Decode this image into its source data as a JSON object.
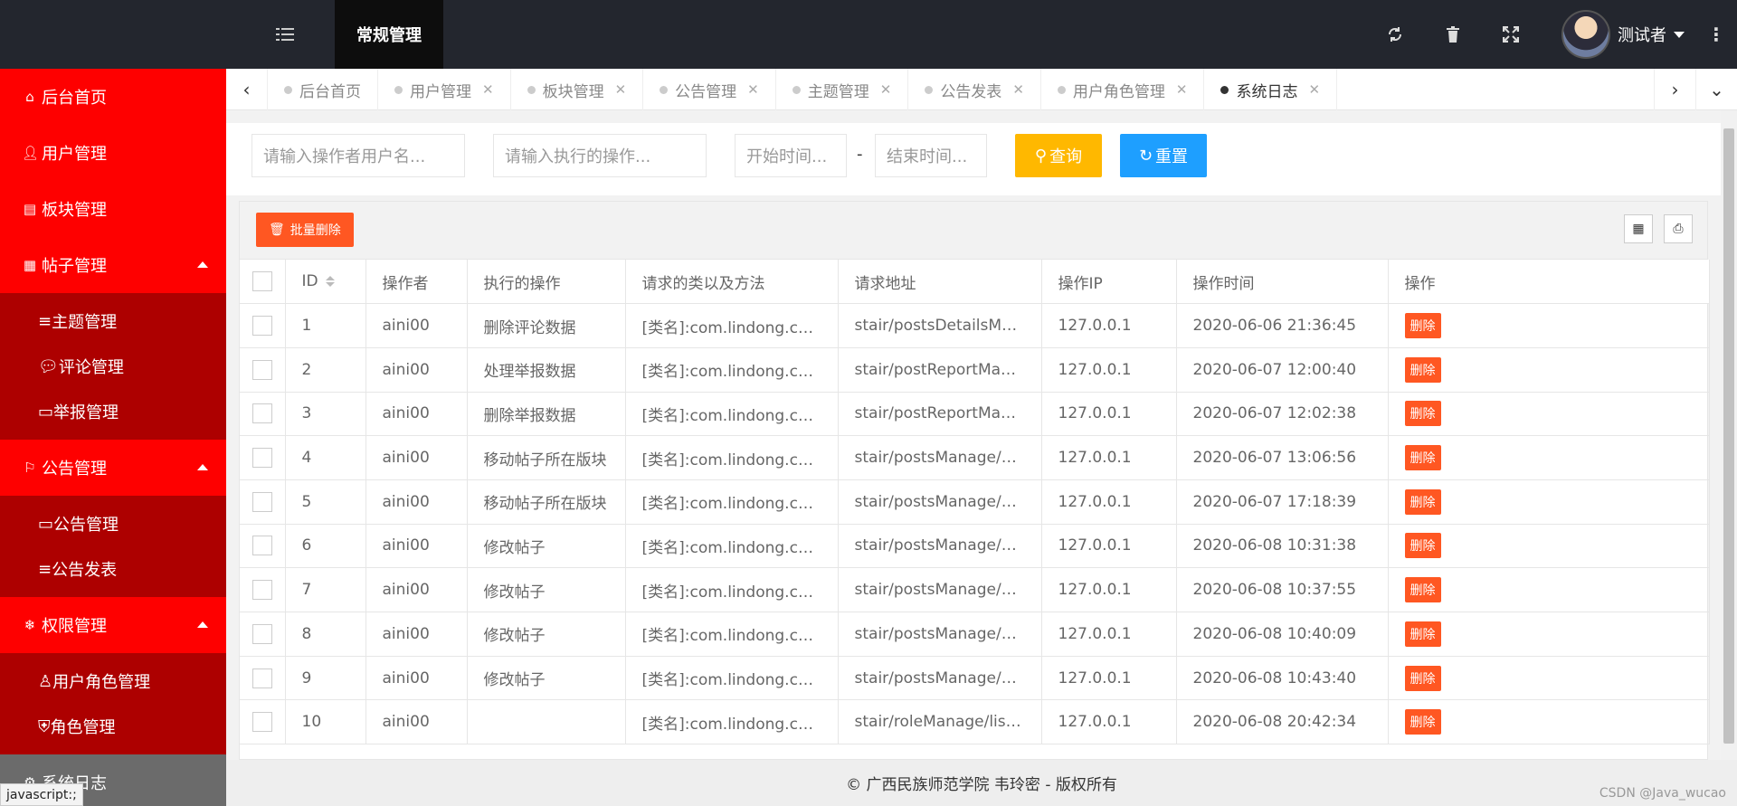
{
  "header": {
    "module": "常规管理",
    "user_name": "测试者"
  },
  "sidebar": {
    "items": [
      {
        "label": "后台首页",
        "icon": "home-icon"
      },
      {
        "label": "用户管理",
        "icon": "user-icon"
      },
      {
        "label": "板块管理",
        "icon": "file-icon"
      },
      {
        "label": "帖子管理",
        "icon": "calendar-icon",
        "expanded": true
      },
      {
        "label": "主题管理",
        "icon": "list-icon"
      },
      {
        "label": "评论管理",
        "icon": "comment-icon"
      },
      {
        "label": "举报管理",
        "icon": "card-icon"
      },
      {
        "label": "公告管理",
        "icon": "flag-icon",
        "expanded": true
      },
      {
        "label": "公告管理",
        "icon": "card-icon"
      },
      {
        "label": "公告发表",
        "icon": "list-icon"
      },
      {
        "label": "权限管理",
        "icon": "snowflake-icon",
        "expanded": true
      },
      {
        "label": "用户角色管理",
        "icon": "user-role-icon"
      },
      {
        "label": "角色管理",
        "icon": "shield-icon"
      },
      {
        "label": "系统日志",
        "icon": "gear-icon"
      }
    ]
  },
  "tabs": [
    {
      "label": "后台首页",
      "closable": false
    },
    {
      "label": "用户管理",
      "closable": true
    },
    {
      "label": "板块管理",
      "closable": true
    },
    {
      "label": "公告管理",
      "closable": true
    },
    {
      "label": "主题管理",
      "closable": true
    },
    {
      "label": "公告发表",
      "closable": true
    },
    {
      "label": "用户角色管理",
      "closable": true
    },
    {
      "label": "系统日志",
      "closable": true,
      "active": true
    }
  ],
  "filters": {
    "operator_placeholder": "请输入操作者用户名...",
    "operation_placeholder": "请输入执行的操作...",
    "start_placeholder": "开始时间...",
    "end_placeholder": "结束时间...",
    "dash": "-",
    "query_label": "查询",
    "reset_label": "重置"
  },
  "toolbar": {
    "batch_delete_label": "批量删除"
  },
  "table": {
    "columns": [
      "ID",
      "操作者",
      "执行的操作",
      "请求的类以及方法",
      "请求地址",
      "操作IP",
      "操作时间",
      "操作"
    ],
    "rows": [
      {
        "id": "1",
        "operator": "aini00",
        "operation": "删除评论数据",
        "method": "[类名]:com.lindong.controller.I...",
        "url": "stair/postsDetailsManagedel...",
        "ip": "127.0.0.1",
        "time": "2020-06-06 21:36:45",
        "action": "删除"
      },
      {
        "id": "2",
        "operator": "aini00",
        "operation": "处理举报数据",
        "method": "[类名]:com.lindong.controller....",
        "url": "stair/postReportManage/dis...",
        "ip": "127.0.0.1",
        "time": "2020-06-07 12:00:40",
        "action": "删除"
      },
      {
        "id": "3",
        "operator": "aini00",
        "operation": "删除举报数据",
        "method": "[类名]:com.lindong.controller....",
        "url": "stair/postReportManage/del...",
        "ip": "127.0.0.1",
        "time": "2020-06-07 12:02:38",
        "action": "删除"
      },
      {
        "id": "4",
        "operator": "aini00",
        "operation": "移动帖子所在版块",
        "method": "[类名]:com.lindong.controller....",
        "url": "stair/postsManage/changPo...",
        "ip": "127.0.0.1",
        "time": "2020-06-07 13:06:56",
        "action": "删除"
      },
      {
        "id": "5",
        "operator": "aini00",
        "operation": "移动帖子所在版块",
        "method": "[类名]:com.lindong.controller....",
        "url": "stair/postsManage/changPo...",
        "ip": "127.0.0.1",
        "time": "2020-06-07 17:18:39",
        "action": "删除"
      },
      {
        "id": "6",
        "operator": "aini00",
        "operation": "修改帖子",
        "method": "[类名]:com.lindong.controller....",
        "url": "stair/postsManage/changPo...",
        "ip": "127.0.0.1",
        "time": "2020-06-08 10:31:38",
        "action": "删除"
      },
      {
        "id": "7",
        "operator": "aini00",
        "operation": "修改帖子",
        "method": "[类名]:com.lindong.controller....",
        "url": "stair/postsManage/changPo...",
        "ip": "127.0.0.1",
        "time": "2020-06-08 10:37:55",
        "action": "删除"
      },
      {
        "id": "8",
        "operator": "aini00",
        "operation": "修改帖子",
        "method": "[类名]:com.lindong.controller....",
        "url": "stair/postsManage/changPo...",
        "ip": "127.0.0.1",
        "time": "2020-06-08 10:40:09",
        "action": "删除"
      },
      {
        "id": "9",
        "operator": "aini00",
        "operation": "修改帖子",
        "method": "[类名]:com.lindong.controller....",
        "url": "stair/postsManage/changPo...",
        "ip": "127.0.0.1",
        "time": "2020-06-08 10:43:40",
        "action": "删除"
      },
      {
        "id": "10",
        "operator": "aini00",
        "operation": "",
        "method": "[类名]:com.lindong.controller....",
        "url": "stair/roleManage/listRole",
        "ip": "127.0.0.1",
        "time": "2020-06-08 20:42:34",
        "action": "删除"
      }
    ]
  },
  "footer": {
    "text": "© 广西民族师范学院 韦玲密 - 版权所有",
    "watermark": "CSDN @Java_wucao"
  },
  "status_bar": "javascript:;",
  "colors": {
    "topbar": "#23262e",
    "sidebar": "#e60000",
    "submenu": "#ad0000",
    "query": "#ffb800",
    "reset": "#1e9fff",
    "danger": "#ff5722"
  }
}
